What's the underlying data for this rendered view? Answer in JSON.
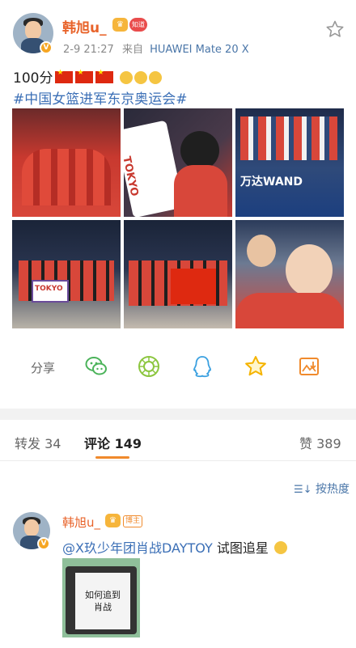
{
  "post": {
    "author": "韩旭u_",
    "author_badge": "知道",
    "timestamp": "2-9 21:27",
    "source_prefix": "来自",
    "device": "HUAWEI Mate 20 X",
    "text": "100分",
    "hashtag": "#中国女篮进军东京奥运会#",
    "photos": [
      {
        "label": "",
        "palette": "team-celebration"
      },
      {
        "label": "TOKYO",
        "palette": "player-banner"
      },
      {
        "label": "万达WAND",
        "palette": "arena-stands"
      },
      {
        "label": "TOKYO",
        "palette": "team-court"
      },
      {
        "label": "",
        "palette": "team-flag"
      },
      {
        "label": "",
        "palette": "selfie"
      }
    ],
    "share_label": "分享",
    "share_icons": [
      "wechat-icon",
      "moments-icon",
      "qq-icon",
      "star-icon",
      "image-save-icon"
    ]
  },
  "tabs": {
    "repost": "转发 34",
    "comments": "评论 149",
    "likes": "赞 389"
  },
  "comments": {
    "sort_label": "按热度",
    "items": [
      {
        "author": "韩旭u_",
        "host_tag": "博主",
        "mention": "@X玖少年团肖战DAYTOY",
        "text": " 试图追星",
        "image_caption": "如何追到\n肖战"
      }
    ]
  },
  "colors": {
    "accent_orange": "#e8632a",
    "link_blue": "#3b6fb6",
    "tab_underline": "#f08a2c",
    "flag_red": "#de2910"
  }
}
